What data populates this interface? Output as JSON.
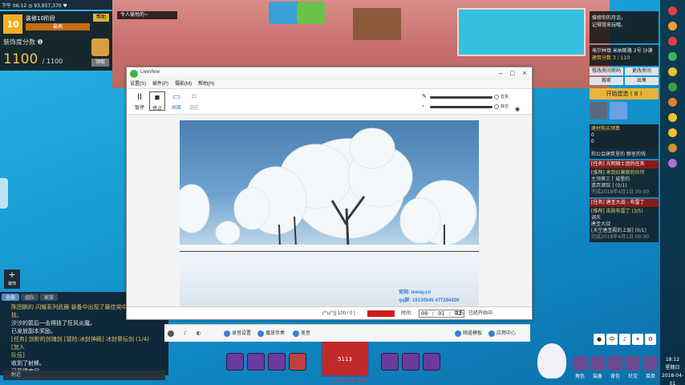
{
  "topbar": {
    "text": "下午 06:12  ◎ 93,957,370  ♥"
  },
  "deco": {
    "level": "10",
    "title": "装修10阶段",
    "help_label": "帮助",
    "max_label": "最高",
    "score_label": "装饰度分数 ❶",
    "score": "1100",
    "score_max": "/ 1100",
    "collect_label": "领取"
  },
  "quest_line": "令人愉悦的~",
  "decorate_button": {
    "icon": "+",
    "label": "装饰"
  },
  "chat": {
    "tabs": [
      "全部",
      "组队",
      "家族"
    ],
    "lines": [
      "陈团鹏的 闪耀系列武器 装备中出现了最佳突中",
      "技。",
      "汐汐的箭后一击得技了狂风炎魔。",
      "已发放副本奖励。",
      "[任务] 剑影的剑瑰剑 [冒险:冰封神殿] 冰封祭坛剑 (1/4) [加入",
      "队伍]",
      "收到了射蜂。",
      "已获得房间。"
    ],
    "input_label": "附近"
  },
  "right_panel": {
    "header": "维修你的月话，\n记得常来玩哦。",
    "info_line1": "埃尔林镇 米纳斯路 2号 沙漠",
    "info_line2": "建筑分数 3 / 110",
    "btns": [
      "修改房间密码",
      "更改房间",
      "搬家",
      "出售"
    ],
    "start_button": "开始建造 ( B )",
    "budget_title": "建材购买预算",
    "budget_values": [
      "0",
      "0"
    ],
    "budget_note": "和公会建筑里的 静室的钱",
    "task1_title": "[任务] 光明骑士团的任务",
    "task1_lines": [
      "[推荐] 来到拉莫斯的伙伴",
      "主领第三 [ 城堡的",
      "遗弃酒馆 ] (0/1)",
      "完成2018年4月1日 00:00"
    ],
    "task2_title": "[任务] 唐圣大战 - 布雷丁",
    "task2_lines": [
      "[推荐] 击败布雷丁 (3/5)",
      "调天",
      "唐圣大战",
      "[天空唐圣殿的上层] (0/1)",
      "完成2018年4月1日 00:00"
    ]
  },
  "livestream": {
    "title": "LiveView",
    "menu": [
      "设置(S)",
      "插件(P)",
      "摄影(M)",
      "帮助(H)"
    ],
    "toolbar": {
      "pause": {
        "glyph": "II",
        "label": "暂停"
      },
      "stop": {
        "glyph": "■",
        "label": "停止"
      },
      "screen": {
        "glyph": "▭",
        "label": "画面"
      },
      "region": {
        "glyph": "⌗",
        "label": "选区"
      }
    },
    "slider1_label": "音量",
    "slider2_label": "静音",
    "watermark1": "官网: leway.cn",
    "watermark2": "qq群: 16130545  477284426",
    "status": {
      "fps": "(*'ω'*)[ 100 / 0 ]",
      "duration_label": "时间:",
      "timer": "00 : 01 : 32",
      "state_label": "状态:",
      "state_value": "已经开始中"
    }
  },
  "ls_taskbar": {
    "items": [
      "录音设置",
      "播放伴奏",
      "美音",
      "频道模板",
      "应用中心"
    ]
  },
  "hud": {
    "shield_text": "5113",
    "level_text": "Lv.55 剑影 冰秀",
    "menu_labels": [
      "角色",
      "装备",
      "背包",
      "社交",
      "菜单"
    ]
  },
  "mini_row": [
    "●",
    "中",
    "♪",
    "☀",
    "⚙"
  ],
  "tray": {
    "time": "18:12",
    "weekday": "星期日",
    "date": "2018-04-01"
  }
}
